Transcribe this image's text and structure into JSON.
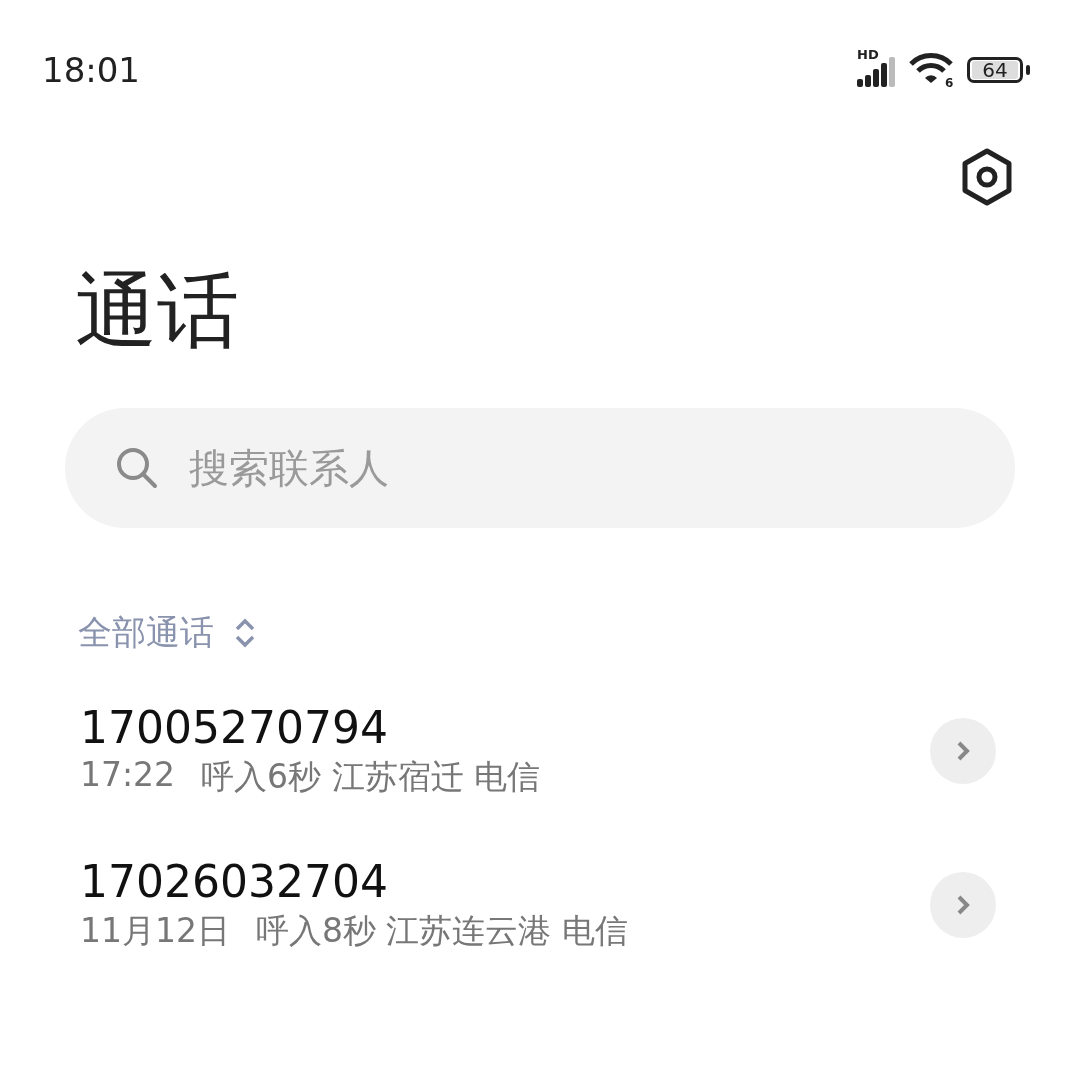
{
  "status_bar": {
    "time": "18:01",
    "network_label": "HD",
    "wifi_label": "6",
    "battery": "64"
  },
  "title": "通话",
  "search": {
    "placeholder": "搜索联系人"
  },
  "filter": {
    "label": "全部通话"
  },
  "calls": [
    {
      "number": "17005270794",
      "time": "17:22",
      "detail": "呼入6秒 江苏宿迁 电信"
    },
    {
      "number": "17026032704",
      "time": "11月12日",
      "detail": "呼入8秒 江苏连云港 电信"
    }
  ]
}
